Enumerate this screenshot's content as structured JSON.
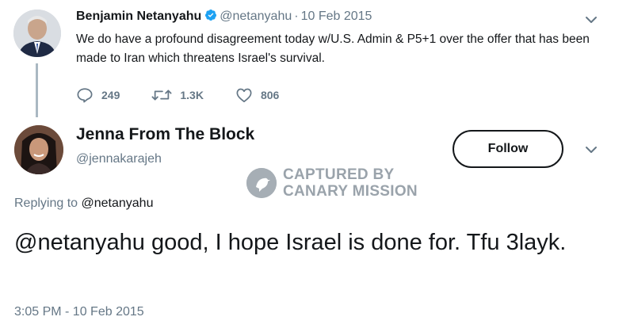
{
  "parent_tweet": {
    "name": "Benjamin Netanyahu",
    "handle": "@netanyahu",
    "separator": "·",
    "date": "10 Feb 2015",
    "text": "We do have a profound disagreement today w/U.S. Admin & P5+1 over the offer that has been made to Iran which threatens Israel's survival.",
    "stats": {
      "replies": "249",
      "retweets": "1.3K",
      "likes": "806"
    }
  },
  "main_tweet": {
    "name": "Jenna From The Block",
    "handle": "@jennakarajeh",
    "follow_label": "Follow",
    "replying_prefix": "Replying to",
    "replying_to": "@netanyahu",
    "text": "@netanyahu good, I hope Israel is done for. Tfu 3layk.",
    "timestamp": "3:05 PM - 10 Feb 2015"
  },
  "watermark": {
    "line1": "CAPTURED BY",
    "line2": "CANARY MISSION"
  },
  "colors": {
    "text_primary": "#14171a",
    "text_secondary": "#657786",
    "verified_blue": "#1da1f2",
    "thread_line": "#aab8c2"
  },
  "icons": {
    "reply": "reply-icon",
    "retweet": "retweet-icon",
    "like": "heart-icon",
    "verified": "verified-badge-icon",
    "caret": "chevron-down-icon"
  }
}
